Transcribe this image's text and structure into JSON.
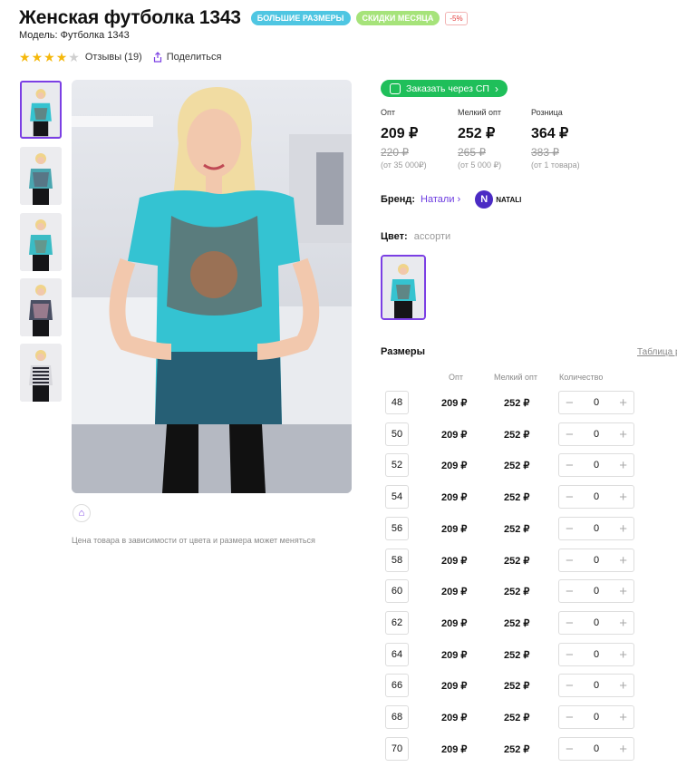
{
  "product": {
    "title": "Женская футболка 1343",
    "badges": [
      "БОЛЬШИЕ РАЗМЕРЫ",
      "СКИДКИ МЕСЯЦА",
      "-5%"
    ],
    "model": "Модель: Футболка 1343",
    "rating": 4,
    "reviews": "Отзывы (19)",
    "share": "Поделиться"
  },
  "order_button": "Заказать через СП",
  "prices": [
    {
      "label": "Опт",
      "value": "209 ₽",
      "old": "220 ₽",
      "min": "(от 35 000₽)"
    },
    {
      "label": "Мелкий опт",
      "value": "252 ₽",
      "old": "265 ₽",
      "min": "(от 5 000 ₽)"
    },
    {
      "label": "Розница",
      "value": "364 ₽",
      "old": "383 ₽",
      "min": "(от 1 товара)"
    }
  ],
  "brand": {
    "label": "Бренд:",
    "name": "Натали",
    "logo_text": "NATALI"
  },
  "color": {
    "label": "Цвет:",
    "value": "ассорти"
  },
  "sizes_title": "Размеры",
  "size_table_link": "Таблица р",
  "columns": {
    "opt": "Опт",
    "small_opt": "Мелкий опт",
    "qty": "Количество"
  },
  "price_note": "Цена товара в зависимости от цвета и размера может меняться",
  "sizes": [
    {
      "size": "48",
      "opt": "209 ₽",
      "small": "252 ₽",
      "qty": "0"
    },
    {
      "size": "50",
      "opt": "209 ₽",
      "small": "252 ₽",
      "qty": "0"
    },
    {
      "size": "52",
      "opt": "209 ₽",
      "small": "252 ₽",
      "qty": "0"
    },
    {
      "size": "54",
      "opt": "209 ₽",
      "small": "252 ₽",
      "qty": "0"
    },
    {
      "size": "56",
      "opt": "209 ₽",
      "small": "252 ₽",
      "qty": "0"
    },
    {
      "size": "58",
      "opt": "209 ₽",
      "small": "252 ₽",
      "qty": "0"
    },
    {
      "size": "60",
      "opt": "209 ₽",
      "small": "252 ₽",
      "qty": "0"
    },
    {
      "size": "62",
      "opt": "209 ₽",
      "small": "252 ₽",
      "qty": "0"
    },
    {
      "size": "64",
      "opt": "209 ₽",
      "small": "252 ₽",
      "qty": "0"
    },
    {
      "size": "66",
      "opt": "209 ₽",
      "small": "252 ₽",
      "qty": "0"
    },
    {
      "size": "68",
      "opt": "209 ₽",
      "small": "252 ₽",
      "qty": "0"
    },
    {
      "size": "70",
      "opt": "209 ₽",
      "small": "252 ₽",
      "qty": "0"
    }
  ],
  "colors": {
    "accent": "#7b3fe4",
    "order": "#1fbf5a",
    "badge_big": "#4fc6e2",
    "badge_sale": "#a6e37a",
    "star": "#f5b80b"
  }
}
